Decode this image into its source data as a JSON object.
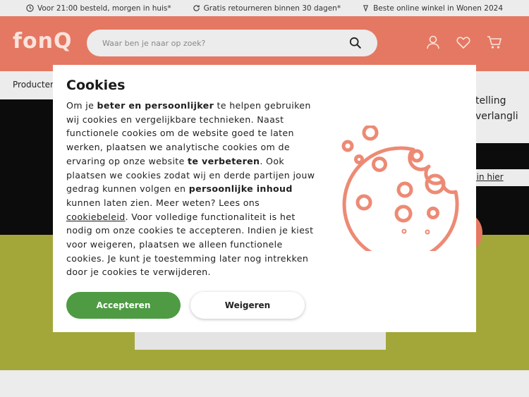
{
  "usp_bar": [
    {
      "icon": "clock-icon",
      "text": "Voor 21:00 besteld, morgen in huis*"
    },
    {
      "icon": "refresh-icon",
      "text": "Gratis retourneren binnen 30 dagen*"
    },
    {
      "icon": "award-icon",
      "text": "Beste online winkel in Wonen 2024"
    }
  ],
  "header": {
    "logo": "fonQ",
    "search_placeholder": "Waar ben je naar op zoek?"
  },
  "nav": {
    "products": "Producten"
  },
  "background": {
    "right_panel_line1": "telling",
    "right_panel_line2": "verlangli",
    "login_link": "gin hier"
  },
  "cookie_dialog": {
    "title": "Cookies",
    "text_1": "Om je ",
    "bold_1": "beter en persoonlijker",
    "text_2": " te helpen gebruiken wij cookies en vergelijkbare technieken. Naast functionele cookies om de website goed te laten werken, plaatsen we analytische cookies om de ervaring op onze website ",
    "bold_2": "te verbeteren",
    "text_3": ". Ook plaatsen we cookies zodat wij en derde partijen jouw gedrag kunnen volgen en ",
    "bold_3": "persoonlijke inhoud",
    "text_4": " kunnen laten zien. Meer weten? Lees ons ",
    "link": "cookiebeleid",
    "text_5": ". Voor volledige functionaliteit is het nodig om onze cookies te accepteren. Indien je kiest voor weigeren, plaatsen we alleen functionele cookies. Je kunt je toestemming later nog intrekken door je cookies te verwijderen.",
    "accept_label": "Accepteren",
    "refuse_label": "Weigeren",
    "illustration": "cookie-icon"
  },
  "colors": {
    "brand": "#e57862",
    "accept": "#4e9b44",
    "green_band": "#a3a739"
  }
}
